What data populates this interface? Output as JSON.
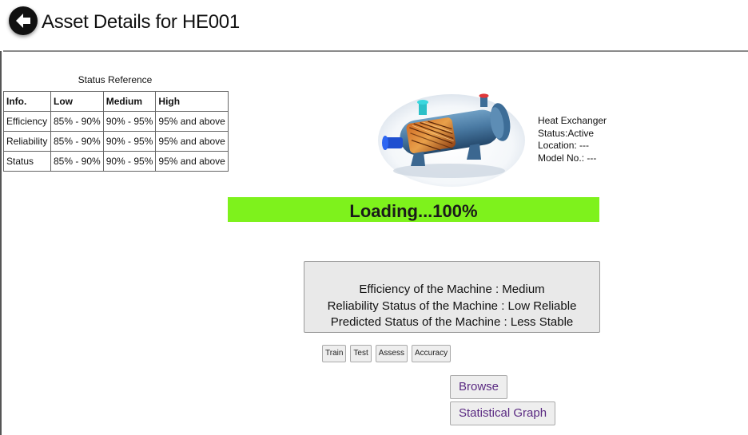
{
  "header": {
    "title": "Asset Details for HE001",
    "back_icon": "arrow-left-icon"
  },
  "status_reference": {
    "caption": "Status Reference",
    "columns": [
      "Info.",
      "Low",
      "Medium",
      "High"
    ],
    "rows": [
      [
        "Efficiency",
        "85% - 90%",
        "90% - 95%",
        "95% and above"
      ],
      [
        "Reliability",
        "85% - 90%",
        "90% - 95%",
        "95% and above"
      ],
      [
        "Status",
        "85% - 90%",
        "90% - 95%",
        "95% and above"
      ]
    ]
  },
  "asset": {
    "image_icon": "heat-exchanger-icon",
    "type": "Heat Exchanger",
    "status": "Status:Active",
    "location": "Location: ---",
    "model": "Model No.: ---"
  },
  "loading": {
    "text": "Loading...100%",
    "progress": 1.0,
    "color": "#7ef21c"
  },
  "results": {
    "efficiency": "Efficiency of the Machine : Medium",
    "reliability": "Reliability Status of the Machine : Low Reliable",
    "predicted": "Predicted Status of the Machine : Less Stable"
  },
  "actions": {
    "train": "Train",
    "test": "Test",
    "assess": "Assess",
    "accuracy": "Accuracy",
    "browse": "Browse",
    "statistical_graph": "Statistical Graph"
  }
}
